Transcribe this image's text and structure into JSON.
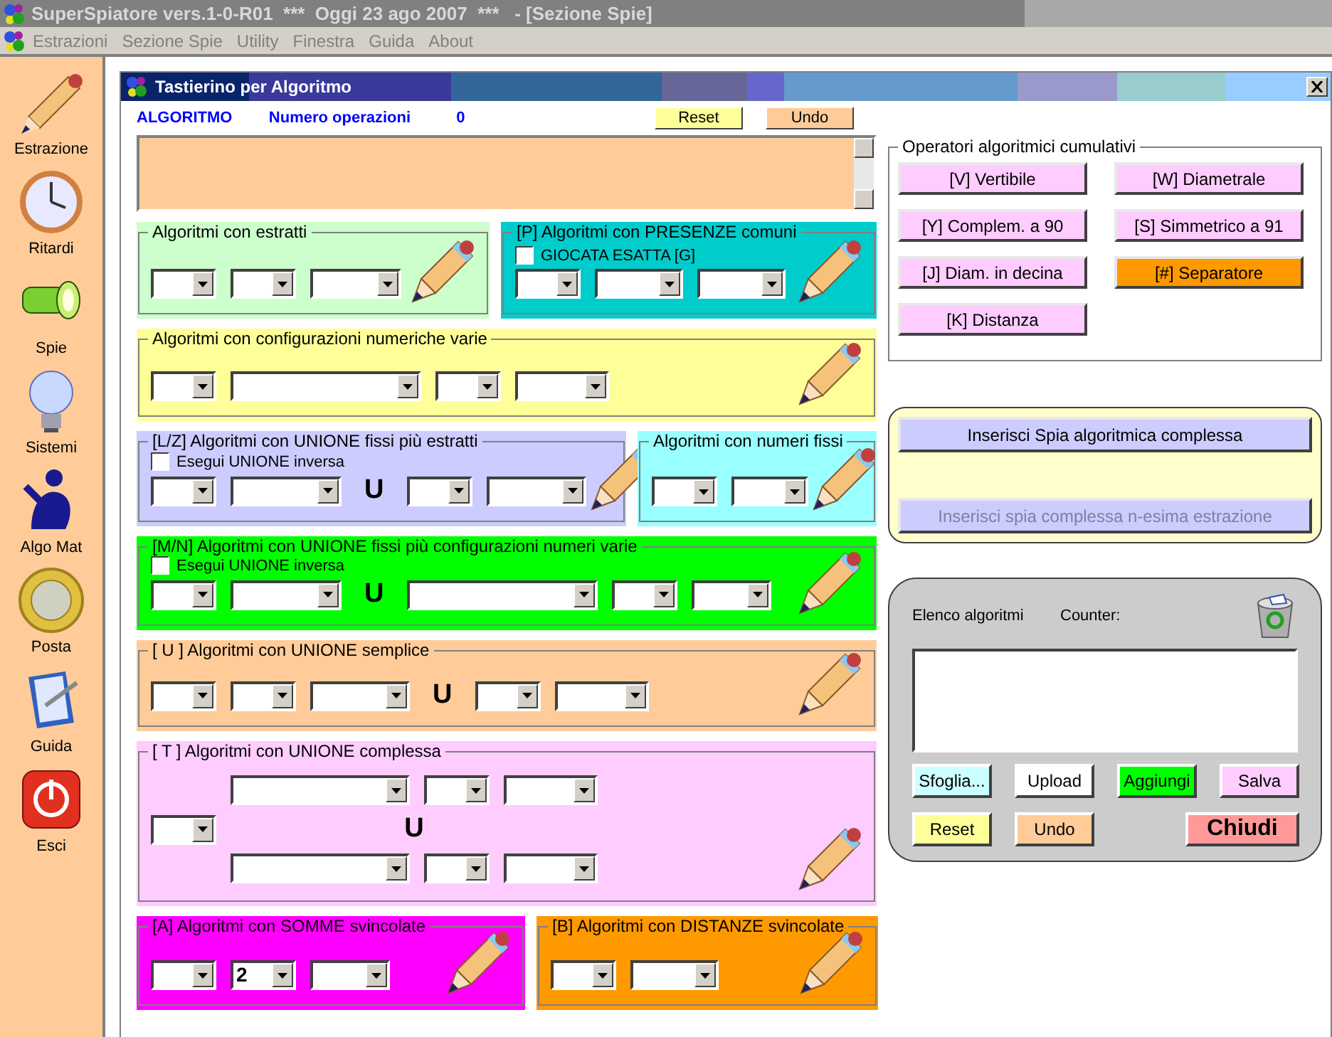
{
  "app_title": "SuperSpiatore vers.1-0-R01  ***  Oggi 23 ago 2007  ***   - [Sezione Spie]",
  "menu": [
    "Estrazioni",
    "Sezione Spie",
    "Utility",
    "Finestra",
    "Guida",
    "About"
  ],
  "sidebar": [
    {
      "label": "Estrazione",
      "kind": "pencil"
    },
    {
      "label": "Ritardi",
      "kind": "clock"
    },
    {
      "label": "Spie",
      "kind": "torch"
    },
    {
      "label": "Sistemi",
      "kind": "bulb"
    },
    {
      "label": "Algo Mat",
      "kind": "figure"
    },
    {
      "label": "Posta",
      "kind": "coin"
    },
    {
      "label": "Guida",
      "kind": "book"
    },
    {
      "label": "Esci",
      "kind": "power"
    }
  ],
  "window": {
    "title": "Tastierino per Algoritmo"
  },
  "header": {
    "algoritmo_label": "ALGORITMO",
    "operations_label": "Numero operazioni",
    "operations_count": "0",
    "buttons": [
      {
        "label": "Reset",
        "color": "#ffff99"
      },
      {
        "label": "Undo",
        "color": "#ffcc99"
      }
    ]
  },
  "panel_rows": [
    [
      {
        "title": "Algoritmi con estratti",
        "color": "#ccffcc",
        "kind": "simple",
        "controls": [
          {
            "kind": "combo"
          },
          {
            "kind": "combo"
          },
          {
            "kind": "combo"
          }
        ]
      },
      {
        "title": "[P] Algoritmi con PRESENZE comuni",
        "color": "#00cccc",
        "kind": "simple",
        "checkbox": {
          "label": "GIOCATA ESATTA  [G]",
          "checked": false
        },
        "controls": [
          {
            "kind": "combo"
          },
          {
            "kind": "combo"
          },
          {
            "kind": "combo"
          }
        ]
      }
    ],
    [
      {
        "title": "Algoritmi con configurazioni numeriche varie",
        "color": "#ffff99",
        "kind": "simple",
        "controls": [
          {
            "kind": "combo"
          },
          {
            "kind": "combo"
          },
          {
            "kind": "combo"
          },
          {
            "kind": "combo"
          }
        ]
      }
    ],
    [
      {
        "title": "[L/Z] Algoritmi con UNIONE fissi più estratti",
        "color": "#ccccff",
        "kind": "simple",
        "checkbox": {
          "label": "Esegui UNIONE inversa",
          "checked": false
        },
        "controls": [
          {
            "kind": "combo"
          },
          {
            "kind": "combo"
          },
          {
            "kind": "union",
            "text": "U"
          },
          {
            "kind": "combo"
          },
          {
            "kind": "combo"
          }
        ]
      },
      {
        "title": "Algoritmi con numeri fissi",
        "color": "#99ffff",
        "kind": "simple",
        "controls": [
          {
            "kind": "combo"
          },
          {
            "kind": "combo"
          }
        ]
      }
    ],
    [
      {
        "title": "[M/N] Algoritmi con UNIONE fissi più configurazioni numeri varie",
        "color": "#00ff00",
        "kind": "simple",
        "checkbox": {
          "label": "Esegui UNIONE inversa",
          "checked": false
        },
        "controls": [
          {
            "kind": "combo"
          },
          {
            "kind": "combo"
          },
          {
            "kind": "union",
            "text": "U"
          },
          {
            "kind": "combo"
          },
          {
            "kind": "combo"
          },
          {
            "kind": "combo"
          }
        ]
      }
    ],
    [
      {
        "title": "[ U ] Algoritmi con UNIONE semplice",
        "color": "#ffcc99",
        "kind": "simple",
        "controls": [
          {
            "kind": "combo"
          },
          {
            "kind": "combo"
          },
          {
            "kind": "combo"
          },
          {
            "kind": "union",
            "text": "U"
          },
          {
            "kind": "combo"
          },
          {
            "kind": "combo"
          }
        ]
      }
    ],
    [
      {
        "title": "[ T ] Algoritmi con UNIONE complessa",
        "color": "#ffccff",
        "kind": "complex",
        "left": [
          {
            "kind": "combo"
          }
        ],
        "top": [
          {
            "kind": "combo"
          },
          {
            "kind": "combo"
          },
          {
            "kind": "combo"
          }
        ],
        "union": "U",
        "bottom": [
          {
            "kind": "combo"
          },
          {
            "kind": "combo"
          },
          {
            "kind": "combo"
          }
        ]
      }
    ],
    [
      {
        "title": "[A] Algoritmi con SOMME svincolate",
        "color": "#ff00ff",
        "kind": "simple",
        "controls": [
          {
            "kind": "combo"
          },
          {
            "kind": "combo",
            "value": "2"
          },
          {
            "kind": "combo"
          }
        ]
      },
      {
        "title": "[B] Algoritmi con DISTANZE svincolate",
        "color": "#ff9900",
        "kind": "simple",
        "controls": [
          {
            "kind": "combo"
          },
          {
            "kind": "combo"
          }
        ]
      }
    ]
  ],
  "operators": {
    "title": "Operatori algoritmici cumulativi",
    "buttons": [
      {
        "label": "[V] Vertibile",
        "color": "#ffccff"
      },
      {
        "label": "[W] Diametrale",
        "color": "#ffccff"
      },
      {
        "label": "[Y] Complem. a 90",
        "color": "#ffccff"
      },
      {
        "label": "[S] Simmetrico  a 91",
        "color": "#ffccff"
      },
      {
        "label": "[J] Diam. in decina",
        "color": "#ffccff"
      },
      {
        "label": "[#] Separatore",
        "color": "#ff9900"
      },
      {
        "label": "[K] Distanza",
        "color": "#ffccff"
      }
    ]
  },
  "insert_buttons": [
    {
      "label": "Inserisci Spia algoritmica complessa",
      "disabled": false
    },
    {
      "label": "Inserisci spia complessa n-esima estrazione",
      "disabled": true
    }
  ],
  "algorithm_list": {
    "title": "Elenco algoritmi",
    "counter_label": "Counter:",
    "buttons": [
      {
        "label": "Sfoglia...",
        "color": "#ccffff"
      },
      {
        "label": "Upload",
        "color": "#ffffff"
      },
      {
        "label": "Aggiungi",
        "color": "#00ff00"
      },
      {
        "label": "Salva",
        "color": "#ffccff"
      },
      {
        "label": "Reset",
        "color": "#ffff99"
      },
      {
        "label": "Undo",
        "color": "#ffcc99"
      }
    ],
    "close_button": {
      "label": "Chiudi",
      "color": "#ff9999"
    }
  }
}
